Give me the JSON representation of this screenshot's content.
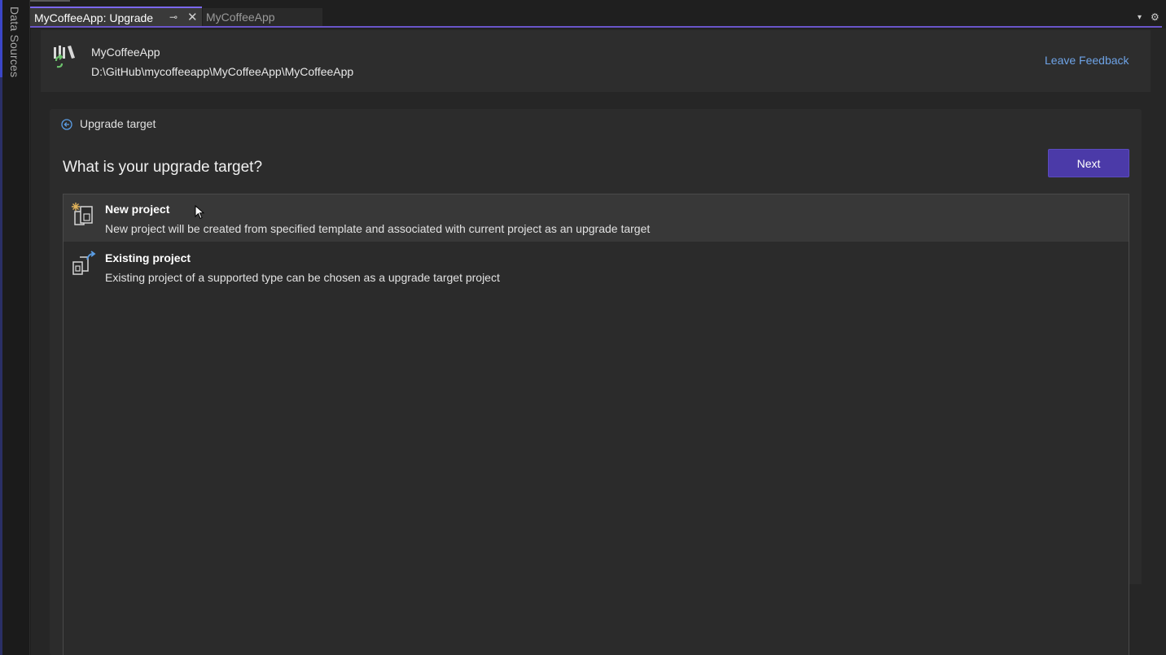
{
  "sidebar": {
    "vertical_tab_label": "Data Sources"
  },
  "tabs": {
    "active": {
      "label": "MyCoffeeApp: Upgrade",
      "pin": "⊸",
      "close": "✕"
    },
    "inactive": {
      "label": "MyCoffeeApp"
    },
    "dropdown": "▾",
    "gear": "⚙"
  },
  "header": {
    "app_name": "MyCoffeeApp",
    "app_path": "D:\\GitHub\\mycoffeeapp\\MyCoffeeApp\\MyCoffeeApp",
    "feedback_label": "Leave Feedback",
    "icon": "upgrade-assistant-icon"
  },
  "wizard": {
    "breadcrumb": "Upgrade target",
    "back_icon": "back-arrow-icon",
    "question": "What is your upgrade target?",
    "next_label": "Next",
    "options": [
      {
        "title": "New project",
        "description": "New project will be created from specified template and associated with current project as an upgrade target",
        "icon": "new-project-icon",
        "selected": true
      },
      {
        "title": "Existing project",
        "description": "Existing project of a supported type can be chosen as a upgrade target project",
        "icon": "existing-project-icon",
        "selected": false
      }
    ]
  },
  "colors": {
    "accent": "#7b68ee",
    "button": "#4b3aa8",
    "link": "#6ea3e6",
    "background": "#1f1f1f"
  }
}
